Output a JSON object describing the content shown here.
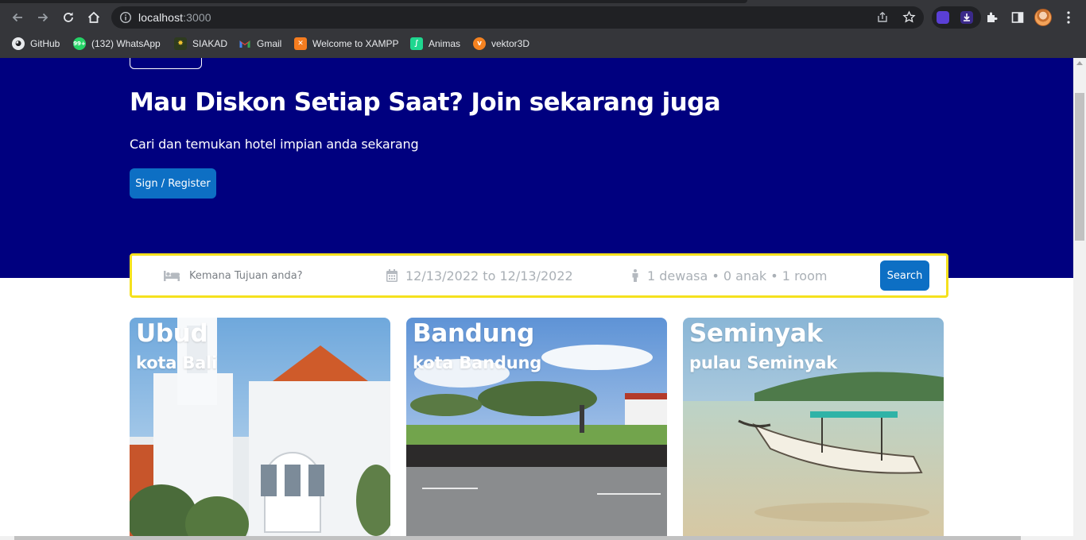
{
  "browser": {
    "url_host": "localhost",
    "url_port": ":3000",
    "bookmarks": [
      {
        "label": "GitHub",
        "icon": "github-icon"
      },
      {
        "label": "(132) WhatsApp",
        "icon": "whatsapp-icon",
        "badge": "99+"
      },
      {
        "label": "SIAKAD",
        "icon": "siakad-icon"
      },
      {
        "label": "Gmail",
        "icon": "gmail-icon"
      },
      {
        "label": "Welcome to XAMPP",
        "icon": "xampp-icon"
      },
      {
        "label": "Animas",
        "icon": "animas-icon"
      },
      {
        "label": "vektor3D",
        "icon": "vektor3d-icon"
      }
    ]
  },
  "hero": {
    "title": "Mau Diskon Setiap Saat? Join sekarang juga",
    "subtitle": "Cari dan temukan hotel impian anda sekarang",
    "cta_label": "Sign / Register",
    "background": "#00007f"
  },
  "search": {
    "destination_placeholder": "Kemana Tujuan anda?",
    "dates": "12/13/2022 to 12/13/2022",
    "guests": "1 dewasa • 0 anak • 1 room",
    "button_label": "Search",
    "border_color": "#f5e11e"
  },
  "cards": [
    {
      "title": "Ubud",
      "subtitle": "kota Bali"
    },
    {
      "title": "Bandung",
      "subtitle": "kota Bandung"
    },
    {
      "title": "Seminyak",
      "subtitle": "pulau Seminyak"
    }
  ],
  "colors": {
    "primary_button": "#0d6fc4",
    "chrome_bg": "#35363a"
  }
}
